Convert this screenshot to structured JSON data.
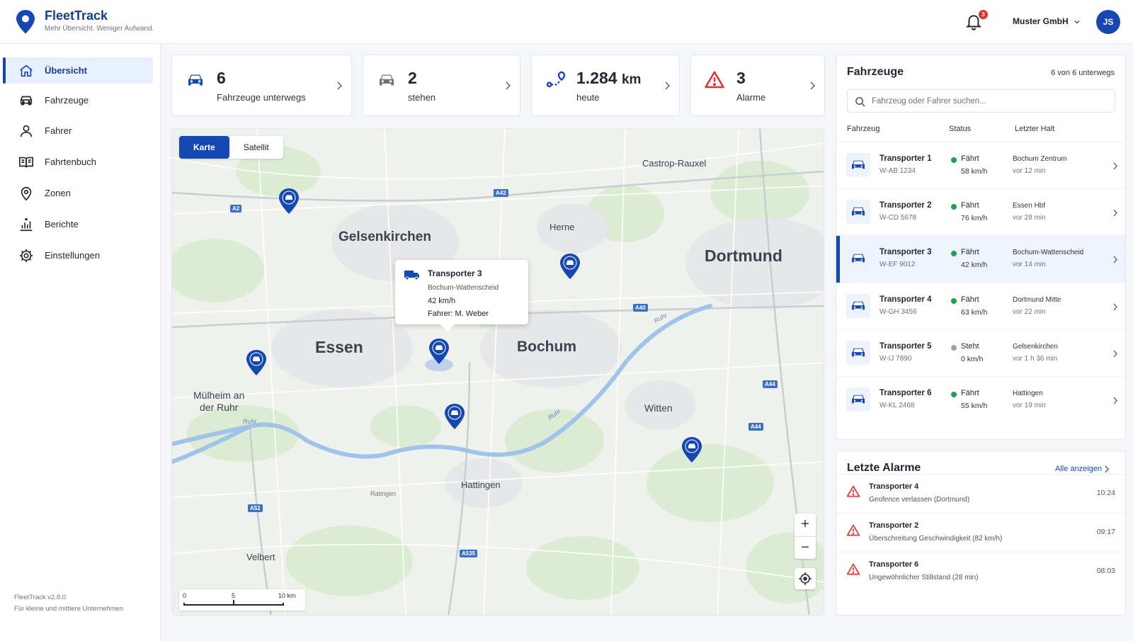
{
  "header": {
    "brand": "FleetTrack",
    "tagline": "Mehr Übersicht. Weniger Aufwand.",
    "notification_count": "3",
    "company": "Muster GmbH",
    "user_initials": "JS"
  },
  "sidebar": {
    "items": [
      {
        "label": "Übersicht",
        "icon": "home-icon",
        "active": true
      },
      {
        "label": "Fahrzeuge",
        "icon": "car-icon"
      },
      {
        "label": "Fahrer",
        "icon": "user-icon"
      },
      {
        "label": "Fahrtenbuch",
        "icon": "book-icon"
      },
      {
        "label": "Zonen",
        "icon": "location-pin-icon"
      },
      {
        "label": "Berichte",
        "icon": "bar-chart-icon"
      },
      {
        "label": "Einstellungen",
        "icon": "gear-icon"
      }
    ],
    "version": "FleetTrack v2.8.0",
    "audience": "Für kleine und mittlere Unternehmen"
  },
  "stats": [
    {
      "value": "6",
      "label": "Fahrzeuge unterwegs",
      "icon": "car-icon"
    },
    {
      "value": "2",
      "label": "stehen",
      "icon": "car-icon"
    },
    {
      "value": "1.284",
      "unit": "km",
      "label": "heute",
      "icon": "route-icon"
    },
    {
      "value": "3",
      "label": "Alarme",
      "icon": "warning-icon"
    }
  ],
  "map": {
    "tabs": [
      "Karte",
      "Satellit"
    ],
    "active_tab": "Karte",
    "cities": {
      "castrop": "Castrop-Rauxel",
      "gelsenkirchen": "Gelsenkirchen",
      "herne": "Herne",
      "dortmund": "Dortmund",
      "essen": "Essen",
      "bochum": "Bochum",
      "muelheim_1": "Mülheim an",
      "muelheim_2": "der Ruhr",
      "witten": "Witten",
      "hattingen": "Hattingen",
      "velbert": "Velbert",
      "ratingen": "Ratingen"
    },
    "roads": [
      "A2",
      "A42",
      "A40",
      "A44",
      "A44",
      "A52",
      "A535"
    ],
    "rivers": [
      "Ruhr",
      "Ruhr",
      "Ruhr"
    ],
    "popup": {
      "title": "Transporter 3",
      "location": "Bochum-Wattenscheid",
      "speed": "42 km/h",
      "driver": "Fahrer: M. Weber"
    },
    "zoom_in": "+",
    "zoom_out": "−",
    "scale": {
      "start": "0",
      "mid": "5",
      "end": "10 km"
    }
  },
  "vehicles_panel": {
    "title": "Fahrzeuge",
    "count": "6 von 6 unterwegs",
    "search_placeholder": "Fahrzeug oder Fahrer suchen...",
    "columns": [
      "Fahrzeug",
      "Status",
      "Letzter Halt"
    ],
    "rows": [
      {
        "name": "Transporter 1",
        "plate": "W-AB 1234",
        "status": "Fährt",
        "speed": "58 km/h",
        "stop": "Bochum Zentrum",
        "ago": "vor 12 min",
        "status_color": "#1aa34a"
      },
      {
        "name": "Transporter 2",
        "plate": "W-CD 5678",
        "status": "Fährt",
        "speed": "76 km/h",
        "stop": "Essen Hbf",
        "ago": "vor 28 min",
        "status_color": "#1aa34a"
      },
      {
        "name": "Transporter 3",
        "plate": "W-EF 9012",
        "status": "Fährt",
        "speed": "42 km/h",
        "stop": "Bochum-Wattenscheid",
        "ago": "vor 14 min",
        "status_color": "#1aa34a",
        "selected": true
      },
      {
        "name": "Transporter 4",
        "plate": "W-GH 3456",
        "status": "Fährt",
        "speed": "63 km/h",
        "stop": "Dortmund Mitte",
        "ago": "vor 22 min",
        "status_color": "#1aa34a"
      },
      {
        "name": "Transporter 5",
        "plate": "W-IJ 7890",
        "status": "Steht",
        "speed": "0 km/h",
        "stop": "Gelsenkirchen",
        "ago": "vor 1 h 36 min",
        "status_color": "#9aa1aa"
      },
      {
        "name": "Transporter 6",
        "plate": "W-KL 2468",
        "status": "Fährt",
        "speed": "55 km/h",
        "stop": "Hattingen",
        "ago": "vor 19 min",
        "status_color": "#1aa34a"
      }
    ]
  },
  "alarms_panel": {
    "title": "Letzte Alarme",
    "show_all": "Alle anzeigen",
    "items": [
      {
        "vehicle": "Transporter 4",
        "desc": "Geofence verlassen (Dortmund)",
        "time": "10:24"
      },
      {
        "vehicle": "Transporter 2",
        "desc": "Überschreitung Geschwindigkeit (82 km/h)",
        "time": "09:17"
      },
      {
        "vehicle": "Transporter 6",
        "desc": "Ungewöhnlicher Stillstand (28 min)",
        "time": "08:03"
      }
    ]
  },
  "colors": {
    "primary": "#1648b3",
    "brand_text": "#173e8a",
    "alert": "#e0312d",
    "moving": "#1aa34a",
    "stopped": "#9aa1aa"
  }
}
